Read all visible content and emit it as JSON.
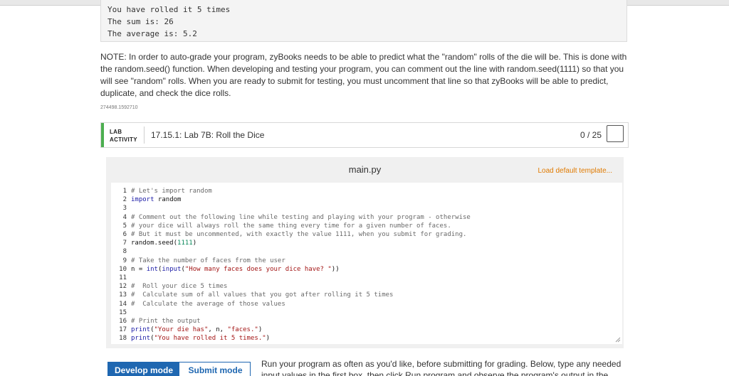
{
  "output_box": {
    "lines": [
      "You have rolled it 5 times",
      "The sum is: 26",
      "The average is: 5.2"
    ]
  },
  "note": {
    "text": "NOTE: In order to auto-grade your program, zyBooks needs to be able to predict what the \"random\" rolls of the die will be. This is done with the random.seed() function. When developing and testing your program, you can comment out the line with random.seed(1111) so that you will see \"random\" rolls. When you are ready to submit for testing, you must uncomment that line so that zyBooks will be able to predict, duplicate, and check the dice rolls."
  },
  "activity_id": "274498.1592710",
  "lab": {
    "tag_line1": "LAB",
    "tag_line2": "ACTIVITY",
    "title": "17.15.1: Lab 7B: Roll the Dice",
    "score": "0 / 25",
    "accent_color": "#4caf50"
  },
  "editor": {
    "filename": "main.py",
    "load_default": "Load default template...",
    "lines": [
      {
        "num": "1",
        "parts": [
          [
            "cmt",
            "# Let's import random"
          ]
        ]
      },
      {
        "num": "2",
        "parts": [
          [
            "kw",
            "import"
          ],
          [
            "plain",
            " random"
          ]
        ]
      },
      {
        "num": "3",
        "parts": []
      },
      {
        "num": "4",
        "parts": [
          [
            "cmt",
            "# Comment out the following line while testing and playing with your program - otherwise"
          ]
        ]
      },
      {
        "num": "5",
        "parts": [
          [
            "cmt",
            "# your dice will always roll the same thing every time for a given number of faces."
          ]
        ]
      },
      {
        "num": "6",
        "parts": [
          [
            "cmt",
            "# But it must be uncommented, with exactly the value 1111, when you submit for grading."
          ]
        ]
      },
      {
        "num": "7",
        "parts": [
          [
            "plain",
            "random.seed("
          ],
          [
            "num",
            "1111"
          ],
          [
            "plain",
            ")"
          ]
        ]
      },
      {
        "num": "8",
        "parts": []
      },
      {
        "num": "9",
        "parts": [
          [
            "cmt",
            "# Take the number of faces from the user"
          ]
        ]
      },
      {
        "num": "10",
        "parts": [
          [
            "plain",
            "n = "
          ],
          [
            "kw",
            "int"
          ],
          [
            "plain",
            "("
          ],
          [
            "kw",
            "input"
          ],
          [
            "plain",
            "("
          ],
          [
            "str",
            "\"How many faces does your dice have? \""
          ],
          [
            "plain",
            "))"
          ]
        ]
      },
      {
        "num": "11",
        "parts": []
      },
      {
        "num": "12",
        "parts": [
          [
            "cmt",
            "#  Roll your dice 5 times"
          ]
        ]
      },
      {
        "num": "13",
        "parts": [
          [
            "cmt",
            "#  Calculate sum of all values that you got after rolling it 5 times"
          ]
        ]
      },
      {
        "num": "14",
        "parts": [
          [
            "cmt",
            "#  Calculate the average of those values"
          ]
        ]
      },
      {
        "num": "15",
        "parts": []
      },
      {
        "num": "16",
        "parts": [
          [
            "cmt",
            "# Print the output"
          ]
        ]
      },
      {
        "num": "17",
        "parts": [
          [
            "kw",
            "print"
          ],
          [
            "plain",
            "("
          ],
          [
            "str",
            "\"Your die has\""
          ],
          [
            "plain",
            ", n, "
          ],
          [
            "str",
            "\"faces.\""
          ],
          [
            "plain",
            ")"
          ]
        ]
      },
      {
        "num": "18",
        "parts": [
          [
            "kw",
            "print"
          ],
          [
            "plain",
            "("
          ],
          [
            "str",
            "\"You have rolled it 5 times.\""
          ],
          [
            "plain",
            ")"
          ]
        ]
      }
    ]
  },
  "modes": {
    "develop": "Develop mode",
    "submit": "Submit mode",
    "active_color": "#1f67b1"
  },
  "run_text": {
    "text": "Run your program as often as you'd like, before submitting for grading. Below, type any needed input values in the first box, then click Run program and observe the program's output in the"
  }
}
